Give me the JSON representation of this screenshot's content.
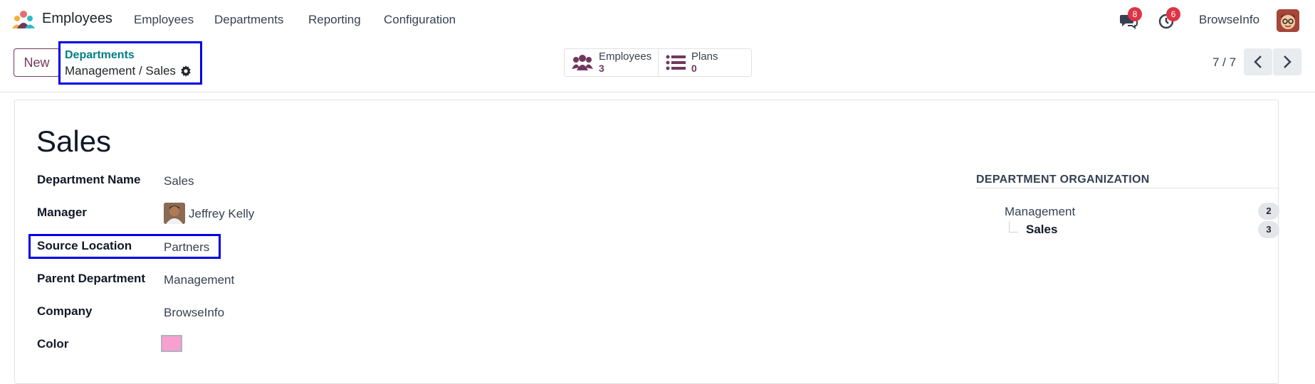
{
  "navbar": {
    "app_name": "Employees",
    "menu": [
      "Employees",
      "Departments",
      "Reporting",
      "Configuration"
    ],
    "messages_count": "8",
    "activities_count": "6",
    "user_name": "BrowseInfo"
  },
  "control_panel": {
    "new_label": "New",
    "breadcrumb_parent": "Departments",
    "breadcrumb_current": "Management / Sales",
    "smart_buttons": [
      {
        "label": "Employees",
        "value": "3",
        "icon": "users-icon"
      },
      {
        "label": "Plans",
        "value": "0",
        "icon": "list-icon"
      }
    ],
    "pager": "7 / 7"
  },
  "form": {
    "title": "Sales",
    "fields": [
      {
        "label": "Department Name",
        "value": "Sales"
      },
      {
        "label": "Manager",
        "value": "Jeffrey Kelly"
      },
      {
        "label": "Source Location",
        "value": "Partners"
      },
      {
        "label": "Parent Department",
        "value": "Management"
      },
      {
        "label": "Company",
        "value": "BrowseInfo"
      },
      {
        "label": "Color",
        "value": "#f7a0d0"
      }
    ]
  },
  "organization": {
    "title": "DEPARTMENT ORGANIZATION",
    "items": [
      {
        "name": "Management",
        "count": "2"
      },
      {
        "name": "Sales",
        "count": "3"
      }
    ]
  },
  "colors": {
    "accent": "#71385f",
    "teal": "#017e84",
    "highlight_box": "#0000e6",
    "badge": "#dc3545"
  }
}
